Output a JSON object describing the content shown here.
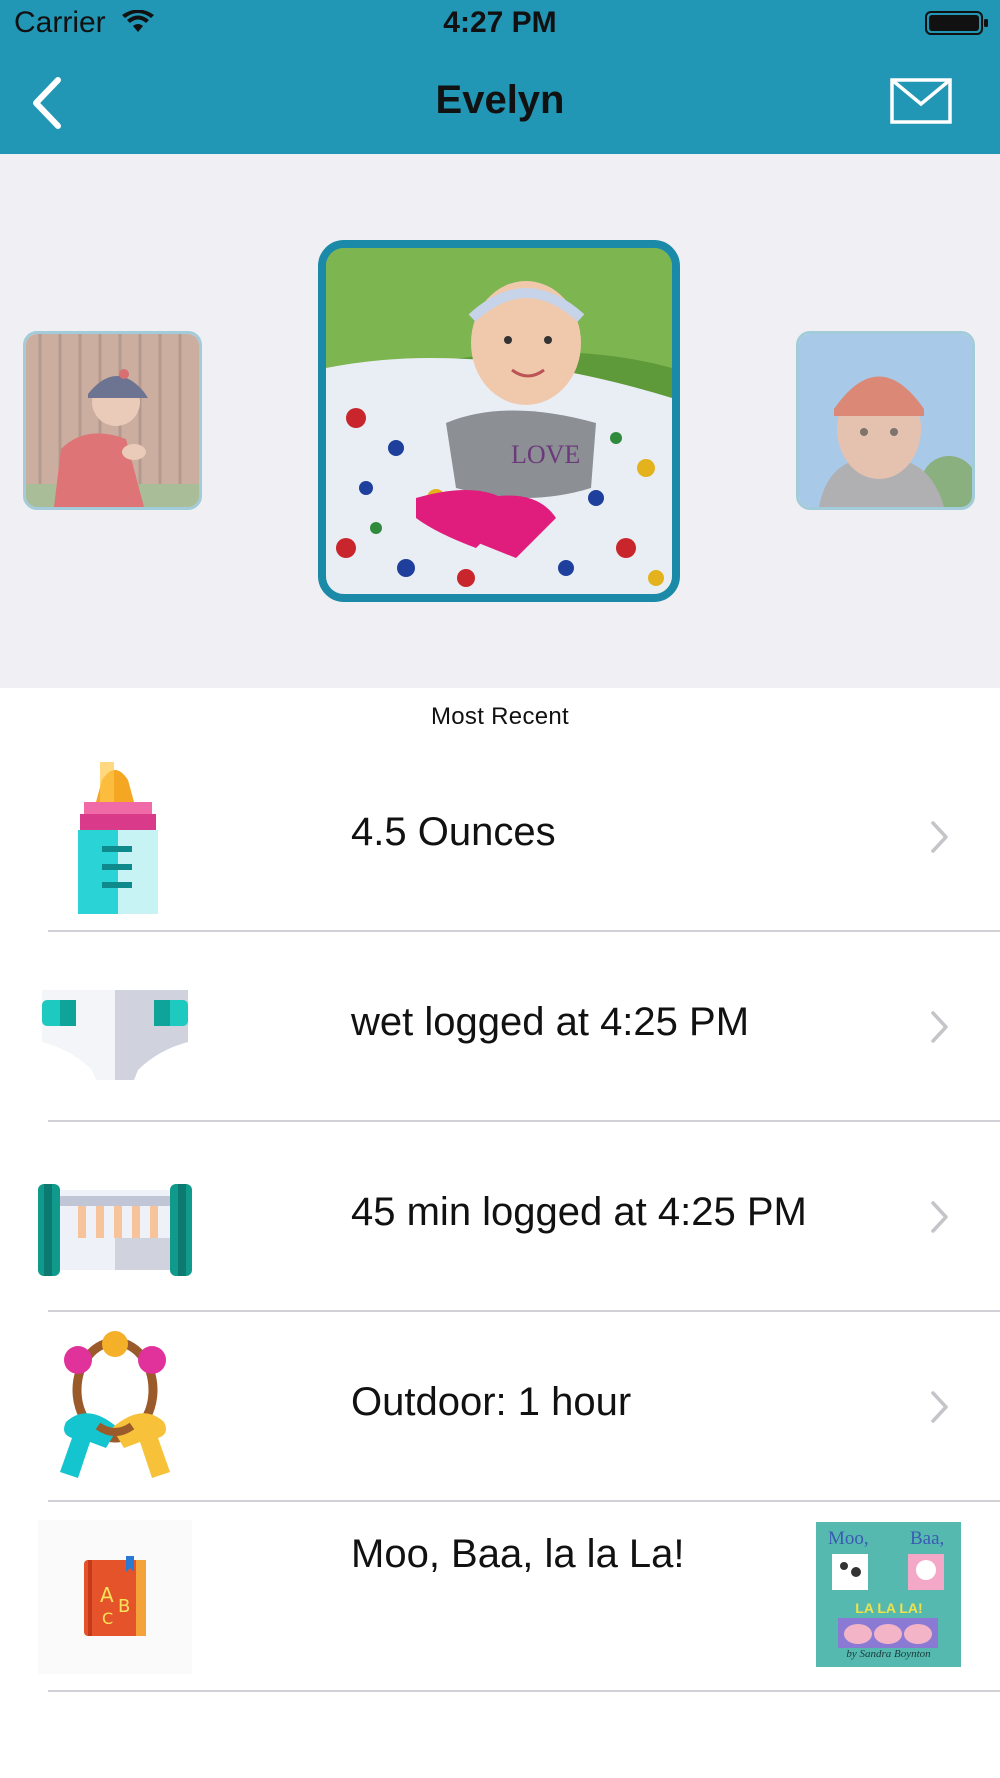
{
  "status_bar": {
    "carrier": "Carrier",
    "time": "4:27 PM"
  },
  "nav": {
    "title": "Evelyn",
    "back_icon": "chevron-left-icon",
    "mail_icon": "envelope-icon"
  },
  "carousel": {
    "photos": [
      {
        "name": "child-boy-red-shirt",
        "selected": false
      },
      {
        "name": "child-evelyn",
        "selected": true
      },
      {
        "name": "child-boy-red-cap",
        "selected": false
      }
    ]
  },
  "section": {
    "label": "Most Recent"
  },
  "rows": [
    {
      "icon": "baby-bottle-icon",
      "label": "4.5 Ounces"
    },
    {
      "icon": "diaper-icon",
      "label": "wet logged at 4:25 PM"
    },
    {
      "icon": "crib-icon",
      "label": "45 min logged at 4:25 PM"
    },
    {
      "icon": "rattle-toy-icon",
      "label": "Outdoor: 1 hour"
    },
    {
      "icon": "book-icon",
      "label": "Moo, Baa, la la La!",
      "cover": {
        "title_left": "Moo,",
        "title_right": "Baa,",
        "banner": "LA LA LA!",
        "author": "by Sandra Boynton"
      }
    }
  ],
  "colors": {
    "header": "#2196b5",
    "carousel_bg": "#efeff4",
    "accent_teal": "#1a8aa8"
  }
}
